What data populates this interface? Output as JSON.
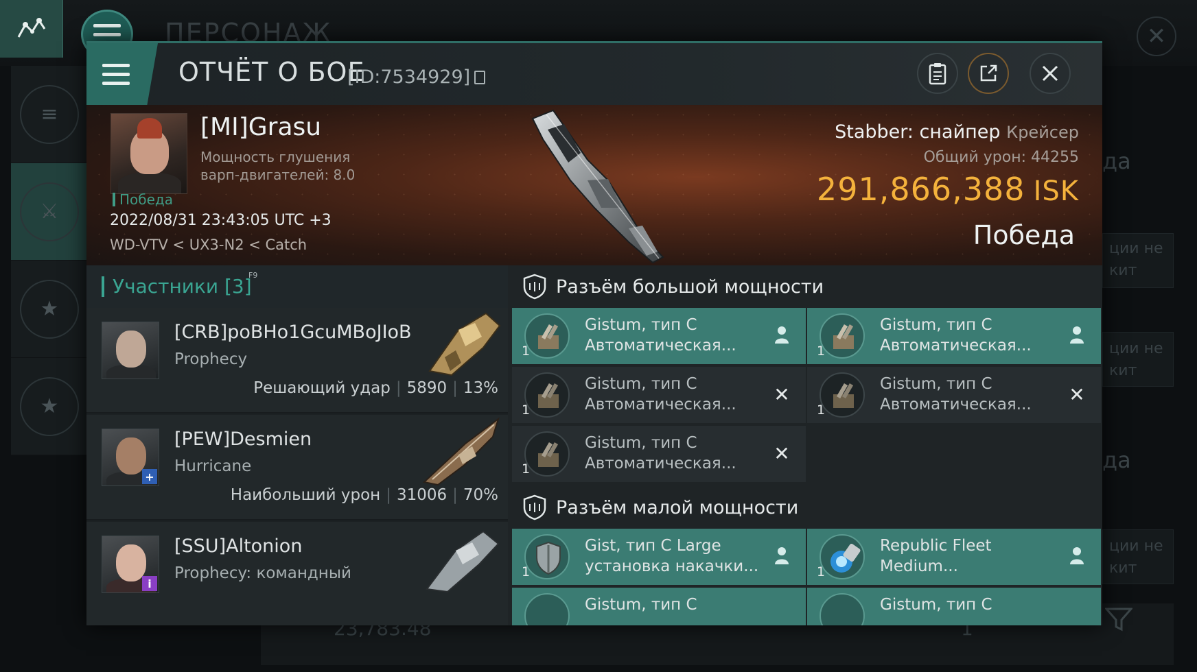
{
  "background": {
    "title": "ПЕРСОНАЖ",
    "right_fragments": [
      "да",
      "ции не",
      "кит",
      "ции не",
      "кит",
      "да",
      "ции не",
      "кит"
    ],
    "bottom_value": "23,783.48",
    "bottom_right_num": "1"
  },
  "dialog": {
    "title": "ОТЧЁТ О БОЕ",
    "id_label": "[ID:7534929]"
  },
  "victim": {
    "name": "[MI]Grasu",
    "stat_line1": "Мощность глушения",
    "stat_line2": "варп-двигателей: 8.0",
    "result_tag": "Победа",
    "datetime": "2022/08/31 23:43:05 UTC +3",
    "route": "WD-VTV < UX3-N2 < Catch",
    "ship_name": "Stabber: снайпер",
    "ship_class": "Крейсер",
    "total_damage_label": "Общий урон:",
    "total_damage_value": "44255",
    "isk_value": "291,866,388",
    "isk_unit": "ISK",
    "outcome": "Победа"
  },
  "participants": {
    "title": "Участники [3]",
    "hotkey": "F9",
    "rows": [
      {
        "name": "[CRB]poBHo1GcuMBoJIoB",
        "ship": "Prophecy",
        "role": "Решающий удар",
        "damage": "5890",
        "percent": "13%"
      },
      {
        "name": "[PEW]Desmien",
        "ship": "Hurricane",
        "role": "Наибольший урон",
        "damage": "31006",
        "percent": "70%"
      },
      {
        "name": "[SSU]Altonion",
        "ship": "Prophecy: командный",
        "role": "",
        "damage": "",
        "percent": ""
      }
    ]
  },
  "high_slots": {
    "title": "Разъём большой мощности",
    "items": [
      {
        "line1": "Gistum, тип C",
        "line2": "Автоматическая...",
        "qty": "1",
        "status": "dropped"
      },
      {
        "line1": "Gistum, тип C",
        "line2": "Автоматическая...",
        "qty": "1",
        "status": "dropped"
      },
      {
        "line1": "Gistum, тип C",
        "line2": "Автоматическая...",
        "qty": "1",
        "status": "destroyed"
      },
      {
        "line1": "Gistum, тип C",
        "line2": "Автоматическая...",
        "qty": "1",
        "status": "destroyed"
      },
      {
        "line1": "Gistum, тип C",
        "line2": "Автоматическая...",
        "qty": "1",
        "status": "destroyed"
      }
    ]
  },
  "low_slots": {
    "title": "Разъём малой мощности",
    "items": [
      {
        "line1": "Gist, тип C Large",
        "line2": "установка накачки...",
        "qty": "1",
        "status": "dropped"
      },
      {
        "line1": "Republic Fleet",
        "line2": "Medium...",
        "qty": "1",
        "status": "dropped"
      },
      {
        "line1": "Gistum, тип C",
        "line2": "",
        "qty": "",
        "status": "dropped"
      },
      {
        "line1": "Gistum, тип C",
        "line2": "",
        "qty": "",
        "status": "dropped"
      }
    ]
  },
  "colors": {
    "accent": "#3aa592",
    "active_module": "#3b7c73",
    "isk": "#f4b23c"
  },
  "icons": [
    "map-icon",
    "menu-icon",
    "close-icon",
    "clipboard-icon",
    "share-icon",
    "shield-icon",
    "pilot-icon",
    "destroyed-x-icon",
    "filter-icon"
  ]
}
